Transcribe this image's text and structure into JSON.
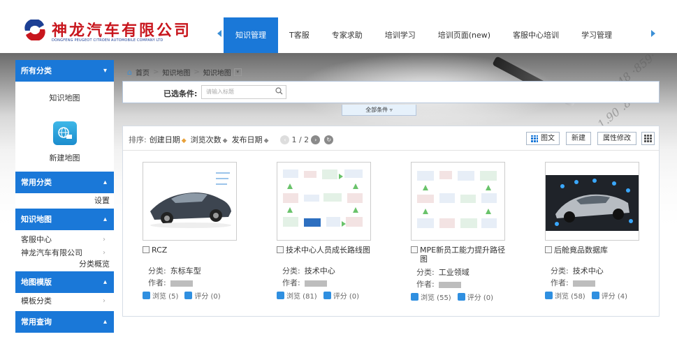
{
  "header": {
    "logo_cn": "神龙汽车有限公司",
    "logo_en": "DONGFENG PEUGEOT CITROEN AUTOMOBILE COMPANY LTD",
    "nav": [
      "知识管理",
      "T客服",
      "专家求助",
      "培训学习",
      "培训页面(new)",
      "客服中心培训",
      "学习管理"
    ],
    "active_nav": 0,
    "accent": "#1a78d8",
    "logo_color": "#c8161d"
  },
  "sidebar": {
    "all_categories": "所有分类",
    "knowledge_map_tile": "知识地图",
    "new_map_tile": "新建地图",
    "common_categories": "常用分类",
    "settings": "设置",
    "knowledge_map_section": "知识地图",
    "customer_center": "客服中心",
    "company": "神龙汽车有限公司",
    "category_overview": "分类概览",
    "map_template": "地图模版",
    "template_category": "模板分类",
    "common_query": "常用查询"
  },
  "breadcrumb": [
    "首页",
    "知识地图",
    "知识地图"
  ],
  "filter": {
    "label": "已选条件:",
    "placeholder": "请输入标题",
    "all_conditions": "全部条件"
  },
  "toolbar": {
    "sort_label": "排序:",
    "sort_options": [
      "创建日期",
      "浏览次数",
      "发布日期"
    ],
    "page": "1 / 2",
    "view_label": "图文",
    "new_label": "新建",
    "attr_label": "属性修改"
  },
  "cards": [
    {
      "title": "RCZ",
      "category_label": "分类:",
      "category": "东标车型",
      "author_label": "作者:",
      "views": "浏览 (5)",
      "rating": "评分 (0)"
    },
    {
      "title": "技术中心人员成长路线图",
      "category_label": "分类:",
      "category": "技术中心",
      "author_label": "作者:",
      "views": "浏览 (81)",
      "rating": "评分 (0)"
    },
    {
      "title": "MPE新员工能力提升路径图",
      "category_label": "分类:",
      "category": "工业领域",
      "author_label": "作者:",
      "views": "浏览 (55)",
      "rating": "评分 (0)"
    },
    {
      "title": "后舱竟品数据库",
      "category_label": "分类:",
      "category": "技术中心",
      "author_label": "作者:",
      "views": "浏览 (58)",
      "rating": "评分 (4)"
    }
  ]
}
